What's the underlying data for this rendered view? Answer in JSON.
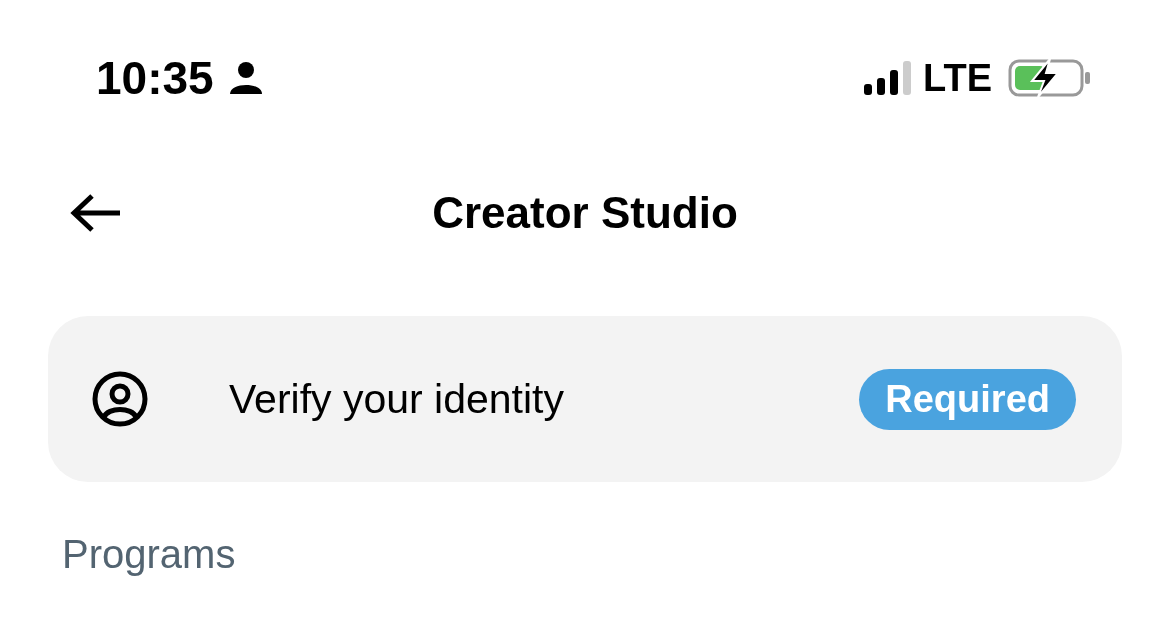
{
  "status_bar": {
    "time": "10:35",
    "network": "LTE"
  },
  "header": {
    "title": "Creator Studio"
  },
  "verify_card": {
    "label": "Verify your identity",
    "badge": "Required"
  },
  "sections": [
    {
      "heading": "Programs"
    }
  ]
}
